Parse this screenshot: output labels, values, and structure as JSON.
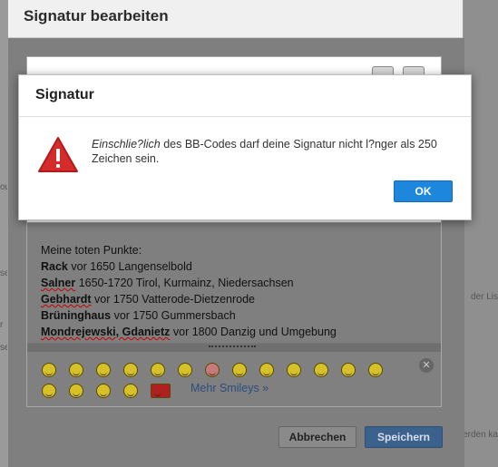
{
  "editor_dialog": {
    "title": "Signatur bearbeiten",
    "signature_lines": [
      {
        "bold": "",
        "rest": "Meine toten Punkte:"
      },
      {
        "bold": "Rack",
        "rest": " vor 1650 Langenselbold"
      },
      {
        "bold": "Salner",
        "rest": " 1650-1720 Tirol, Kurmainz, Niedersachsen"
      },
      {
        "bold": "Gebhardt",
        "rest": " vor 1750 Vatterode-Dietzenrode"
      },
      {
        "bold": "Brüninghaus",
        "rest": " vor 1750 Gummersbach"
      },
      {
        "bold": "Mondrejewski, Gdanietz",
        "rest": " vor 1800 Danzig und Umgebung"
      }
    ],
    "more_smileys": "Mehr Smileys »",
    "cancel_label": "Abbrechen",
    "save_label": "Speichern"
  },
  "background": {
    "right_snippets": [
      "der Lis",
      "erden ka"
    ],
    "left_snippets": [
      "se",
      "ou",
      "r",
      "se"
    ]
  },
  "alert": {
    "title": "Signatur",
    "message_italic": "Einschlie?lich",
    "message_rest": " des BB-Codes darf deine Signatur nicht l?nger als 250 Zeichen sein.",
    "ok_label": "OK",
    "icon": "warning-icon",
    "accent_color": "#1d86dd",
    "warning_color": "#d42b2b"
  }
}
